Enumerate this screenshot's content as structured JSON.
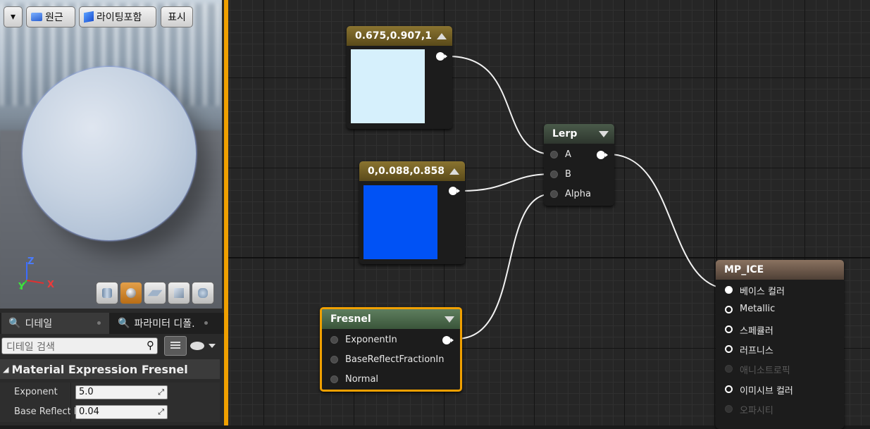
{
  "viewport": {
    "dropdown_label": "▾",
    "perspective_label": "원근",
    "lighting_label": "라이팅포함",
    "show_label": "표시",
    "axis": {
      "z": "Z",
      "y": "Y",
      "x": "X"
    }
  },
  "panel": {
    "tabs": [
      {
        "label": "디테일"
      },
      {
        "label": "파라미터 디폴."
      }
    ],
    "search_placeholder": "디테일 검색",
    "section_title": "Material Expression Fresnel",
    "properties": [
      {
        "label": "Exponent",
        "value": "5.0"
      },
      {
        "label": "Base Reflect F",
        "value": "0.04"
      }
    ]
  },
  "graph": {
    "const1": {
      "title": "0.675,0.907,1",
      "color": "#d6f0fc"
    },
    "const2": {
      "title": "0,0.088,0.858",
      "color": "#0052f5"
    },
    "lerp": {
      "title": "Lerp",
      "inputs": [
        "A",
        "B",
        "Alpha"
      ]
    },
    "fresnel": {
      "title": "Fresnel",
      "inputs": [
        "ExponentIn",
        "BaseReflectFractionIn",
        "Normal"
      ]
    },
    "material": {
      "title": "MP_ICE",
      "inputs": [
        {
          "label": "베이스 컬러"
        },
        {
          "label": "Metallic"
        },
        {
          "label": "스페큘러"
        },
        {
          "label": "러프니스"
        },
        {
          "label": "애니소트로픽"
        },
        {
          "label": "이미시브 컬러"
        },
        {
          "label": "오파시티"
        }
      ]
    }
  },
  "colors": {
    "accent_orange": "#f0a000",
    "const_header": "#7a6520",
    "lerp_header": "#3e4a3e",
    "fresnel_header": "#4b6a4b",
    "material_header": "#6e5a4c"
  }
}
